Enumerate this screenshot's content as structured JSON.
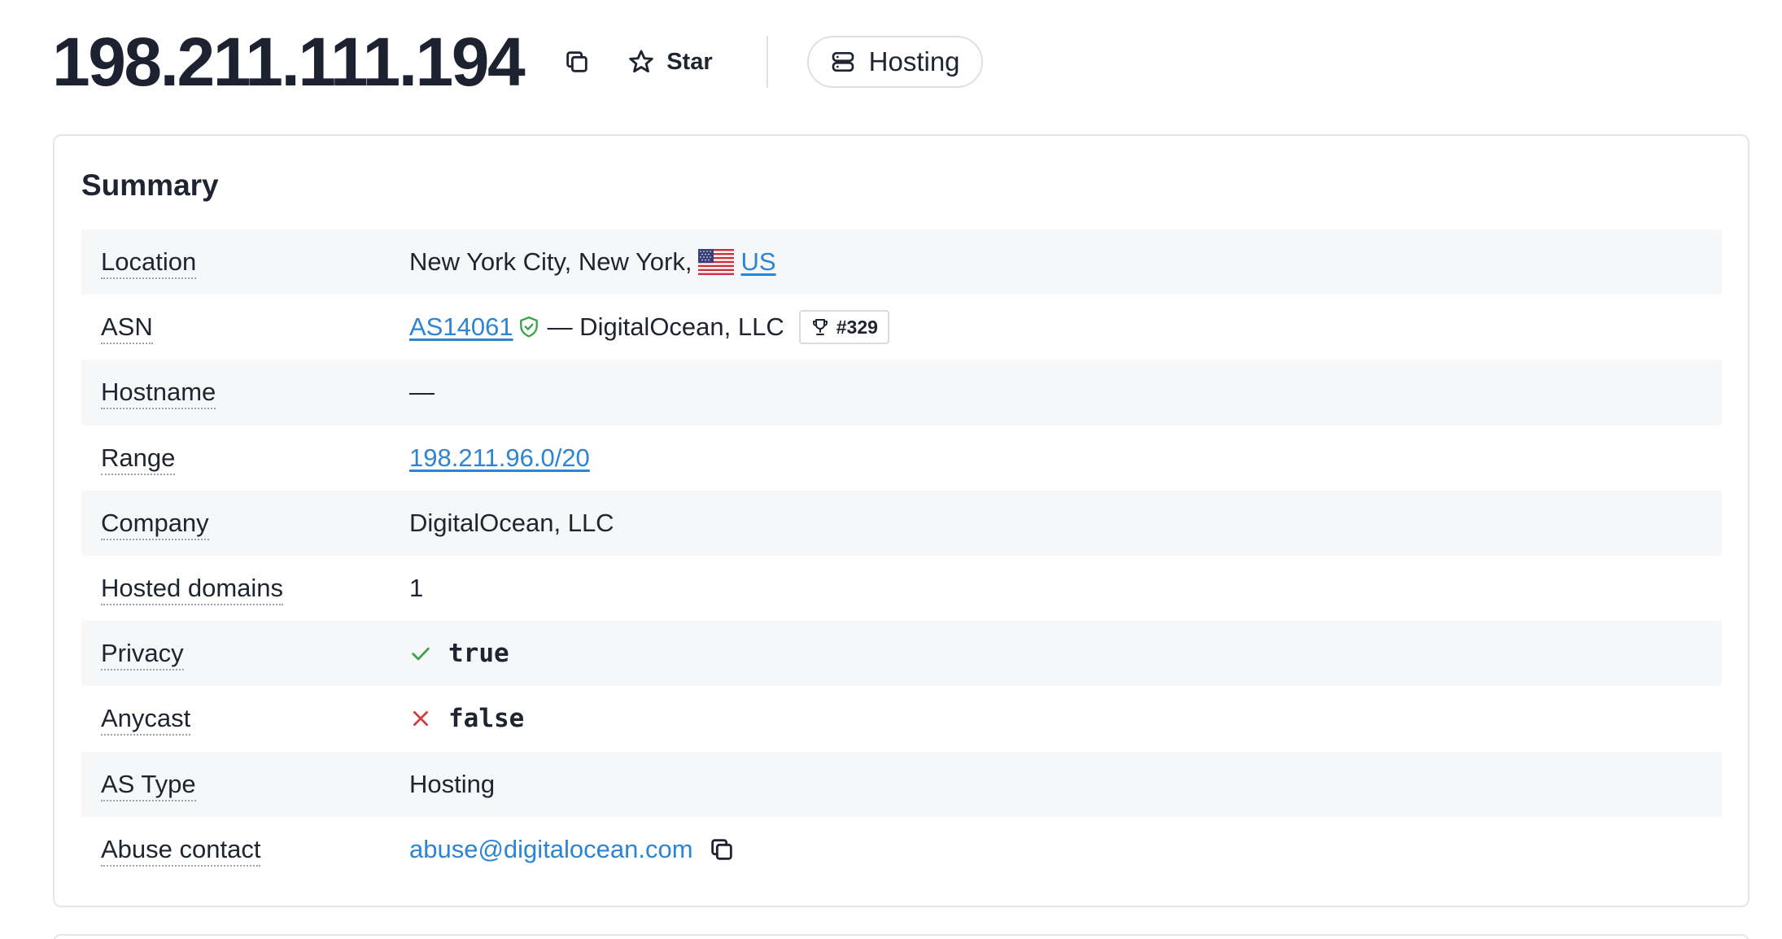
{
  "header": {
    "ip": "198.211.111.194",
    "star_label": "Star",
    "tag_label": "Hosting"
  },
  "summary": {
    "title": "Summary",
    "rows": {
      "location": {
        "label": "Location",
        "text": "New York City, New York,",
        "country": "US",
        "flag_icon": "us-flag-icon"
      },
      "asn": {
        "label": "ASN",
        "asn": "AS14061",
        "org": "— DigitalOcean, LLC",
        "rank": "#329",
        "verified_color": "#3fa34d"
      },
      "hostname": {
        "label": "Hostname",
        "value": "—"
      },
      "range": {
        "label": "Range",
        "value": "198.211.96.0/20"
      },
      "company": {
        "label": "Company",
        "value": "DigitalOcean, LLC"
      },
      "hosted_domains": {
        "label": "Hosted domains",
        "value": "1"
      },
      "privacy": {
        "label": "Privacy",
        "value": "true",
        "icon_color": "#3fa34d"
      },
      "anycast": {
        "label": "Anycast",
        "value": "false",
        "icon_color": "#d23c3c"
      },
      "as_type": {
        "label": "AS Type",
        "value": "Hosting"
      },
      "abuse": {
        "label": "Abuse contact",
        "value": "abuse@digitalocean.com"
      }
    }
  },
  "colors": {
    "link": "#2d84d3",
    "row_shade": "#f6f7f8",
    "text": "#1f2430"
  }
}
